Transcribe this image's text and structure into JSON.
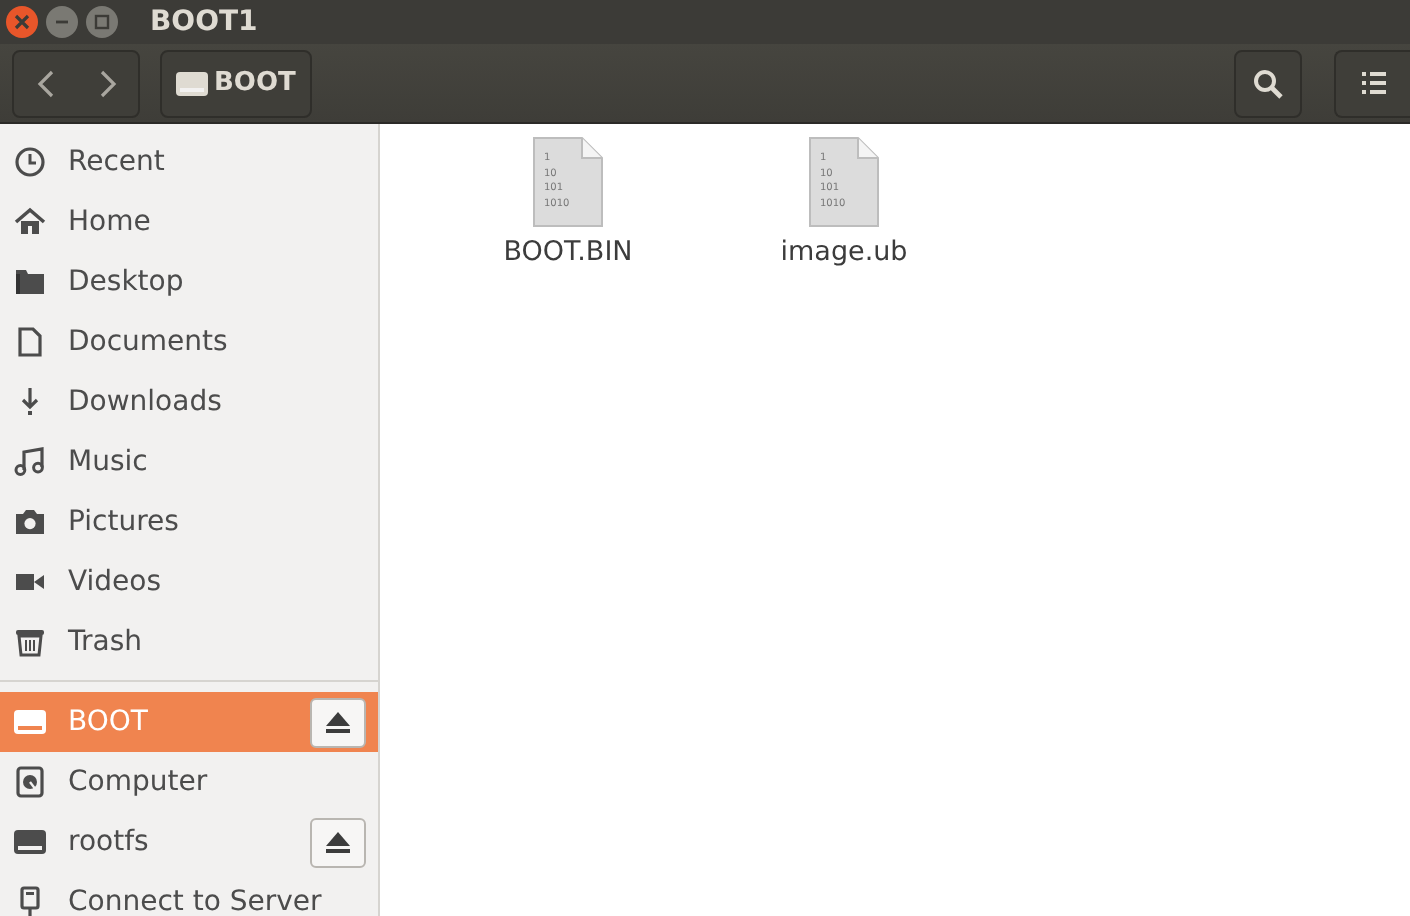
{
  "window": {
    "title": "BOOT1"
  },
  "toolbar": {
    "path": [
      {
        "label": "BOOT"
      }
    ]
  },
  "sidebar": {
    "sections": [
      {
        "items": [
          {
            "label": "Recent",
            "kind": "recent",
            "selected": false,
            "ejectable": false
          },
          {
            "label": "Home",
            "kind": "home",
            "selected": false,
            "ejectable": false
          },
          {
            "label": "Desktop",
            "kind": "folder",
            "selected": false,
            "ejectable": false
          },
          {
            "label": "Documents",
            "kind": "document",
            "selected": false,
            "ejectable": false
          },
          {
            "label": "Downloads",
            "kind": "download",
            "selected": false,
            "ejectable": false
          },
          {
            "label": "Music",
            "kind": "music",
            "selected": false,
            "ejectable": false
          },
          {
            "label": "Pictures",
            "kind": "camera",
            "selected": false,
            "ejectable": false
          },
          {
            "label": "Videos",
            "kind": "video",
            "selected": false,
            "ejectable": false
          },
          {
            "label": "Trash",
            "kind": "trash",
            "selected": false,
            "ejectable": false
          }
        ]
      },
      {
        "items": [
          {
            "label": "BOOT",
            "kind": "drive",
            "selected": true,
            "ejectable": true
          },
          {
            "label": "Computer",
            "kind": "disk",
            "selected": false,
            "ejectable": false
          },
          {
            "label": "rootfs",
            "kind": "drive",
            "selected": false,
            "ejectable": true
          },
          {
            "label": "Connect to Server",
            "kind": "server",
            "selected": false,
            "ejectable": false
          }
        ]
      }
    ]
  },
  "files": [
    {
      "name": "BOOT.BIN",
      "icon_text": [
        "1",
        "10",
        "101",
        "1010"
      ]
    },
    {
      "name": "image.ub",
      "icon_text": [
        "1",
        "10",
        "101",
        "1010"
      ]
    }
  ]
}
